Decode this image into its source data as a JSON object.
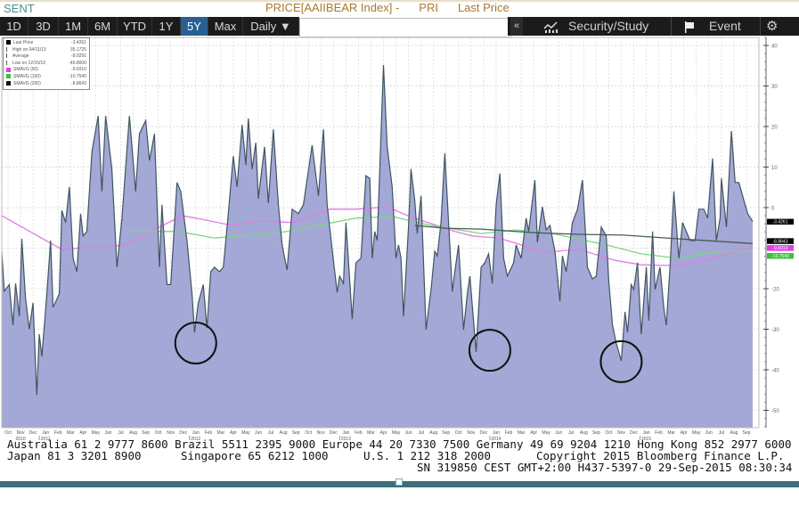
{
  "header": {
    "ticker_label": "SENT",
    "title_parts": [
      "PRICE[AAIIBEAR Index] -",
      "PRI",
      "Last Price"
    ]
  },
  "toolbar": {
    "ranges": [
      "1D",
      "3D",
      "1M",
      "6M",
      "YTD",
      "1Y",
      "5Y",
      "Max"
    ],
    "active_range": "5Y",
    "frequency": "Daily",
    "frequency_arrow": "▼",
    "input_value": "",
    "collapse_label": "«",
    "security_study_label": "Security/Study",
    "event_label": "Event",
    "icons": [
      "chart-study-icon",
      "flag-icon",
      "gear-icon"
    ]
  },
  "legend": [
    {
      "label": "Last Price",
      "value": "-3.4261",
      "color": "#000000",
      "marker": "square"
    },
    {
      "label": "High on 04/11/13",
      "value": "35.1725",
      "color": "#555555",
      "marker": "high"
    },
    {
      "label": "Average",
      "value": "-8.0291",
      "color": "#555555",
      "marker": "avg"
    },
    {
      "label": "Low on 12/15/10",
      "value": "-46.8000",
      "color": "#555555",
      "marker": "low"
    },
    {
      "label": "SMAVG (50)",
      "value": "-9.6910",
      "color": "#e040e0",
      "marker": "square"
    },
    {
      "label": "SMAVG (100)",
      "value": "-10.7540",
      "color": "#3cc03c",
      "marker": "square"
    },
    {
      "label": "SMAVG (200)",
      "value": "-8.8643",
      "color": "#111111",
      "marker": "square"
    }
  ],
  "chart_data": {
    "type": "area",
    "title": "PRICE[AAIIBEAR Index] - PRI Last Price",
    "x_unit": "months since Oct 2010",
    "xlim": [
      0,
      60.5
    ],
    "ylim": [
      -55,
      42
    ],
    "y_ticks": [
      40,
      30,
      20,
      10,
      0,
      -20,
      -30,
      -40,
      -50
    ],
    "month_labels": [
      "Oct",
      "Nov",
      "Dec",
      "Jan",
      "Feb",
      "Mar",
      "Apr",
      "May",
      "Jun",
      "Jul",
      "Aug",
      "Sep",
      "Oct",
      "Nov",
      "Dec",
      "Jan",
      "Feb",
      "Mar",
      "Apr",
      "May",
      "Jun",
      "Jul",
      "Aug",
      "Sep",
      "Oct",
      "Nov",
      "Dec",
      "Jan",
      "Feb",
      "Mar",
      "Apr",
      "May",
      "Jun",
      "Jul",
      "Aug",
      "Sep",
      "Oct",
      "Nov",
      "Dec",
      "Jan",
      "Feb",
      "Mar",
      "Apr",
      "May",
      "Jun",
      "Jul",
      "Aug",
      "Sep",
      "Oct",
      "Nov",
      "Dec",
      "Jan",
      "Feb",
      "Mar",
      "Apr",
      "May",
      "Jun",
      "Jul",
      "Aug",
      "Sep"
    ],
    "year_labels": [
      {
        "label": "2010",
        "month": 1
      },
      {
        "label": "2011",
        "month": 3
      },
      {
        "label": "2012",
        "month": 15
      },
      {
        "label": "2013",
        "month": 27
      },
      {
        "label": "2014",
        "month": 39
      },
      {
        "label": "2015",
        "month": 51
      }
    ],
    "grid": true,
    "series": [
      {
        "name": "Last Price",
        "color": "#3f5560",
        "fill_top": "#8fd3e3",
        "fill_bottom": "#a3a8d6",
        "points": [
          [
            0,
            -11
          ],
          [
            0.2,
            -20.6
          ],
          [
            0.6,
            -19
          ],
          [
            0.9,
            -29
          ],
          [
            1.1,
            -18.7
          ],
          [
            1.4,
            -26.8
          ],
          [
            1.6,
            -7.7
          ],
          [
            1.9,
            -22.4
          ],
          [
            2.2,
            -30
          ],
          [
            2.5,
            -23.5
          ],
          [
            2.8,
            -46.2
          ],
          [
            3.0,
            -31.2
          ],
          [
            3.2,
            -36.7
          ],
          [
            3.6,
            -21.3
          ],
          [
            3.9,
            -8.1
          ],
          [
            4.1,
            -24.6
          ],
          [
            4.6,
            -21.3
          ],
          [
            4.8,
            -0.7
          ],
          [
            5.1,
            -3.7
          ],
          [
            5.4,
            5.1
          ],
          [
            5.7,
            -12.5
          ],
          [
            6.0,
            -15.8
          ],
          [
            6.3,
            -1.5
          ],
          [
            6.5,
            -7
          ],
          [
            6.8,
            -5.9
          ],
          [
            7.2,
            13.8
          ],
          [
            7.7,
            22.6
          ],
          [
            8.0,
            4
          ],
          [
            8.3,
            22.6
          ],
          [
            8.8,
            9.5
          ],
          [
            9.2,
            -14.7
          ],
          [
            9.6,
            -2.6
          ],
          [
            10.2,
            22.6
          ],
          [
            10.7,
            4
          ],
          [
            11.0,
            18.2
          ],
          [
            11.5,
            21.5
          ],
          [
            11.8,
            11.6
          ],
          [
            12.2,
            18.2
          ],
          [
            12.6,
            -14.7
          ],
          [
            12.8,
            0.7
          ],
          [
            13.2,
            -19
          ],
          [
            13.5,
            -19
          ],
          [
            14.0,
            6.2
          ],
          [
            14.3,
            4
          ],
          [
            14.8,
            -8.1
          ],
          [
            15.2,
            -21.3
          ],
          [
            15.4,
            -30.8
          ],
          [
            15.7,
            -23.5
          ],
          [
            16.1,
            -19
          ],
          [
            16.4,
            -29.7
          ],
          [
            16.7,
            -15.8
          ],
          [
            17.0,
            -14.7
          ],
          [
            17.4,
            -15.8
          ],
          [
            17.7,
            -14.7
          ],
          [
            18.1,
            -1.5
          ],
          [
            18.5,
            12.7
          ],
          [
            18.8,
            5.1
          ],
          [
            19.2,
            20.4
          ],
          [
            19.5,
            10.5
          ],
          [
            19.7,
            22
          ],
          [
            20.0,
            9.5
          ],
          [
            20.3,
            16
          ],
          [
            20.5,
            2.2
          ],
          [
            21.0,
            15
          ],
          [
            21.3,
            1.1
          ],
          [
            21.7,
            19.3
          ],
          [
            22.1,
            0.7
          ],
          [
            22.4,
            -9.2
          ],
          [
            22.8,
            -15.4
          ],
          [
            23.2,
            -0.4
          ],
          [
            23.7,
            -1.5
          ],
          [
            24.1,
            0.7
          ],
          [
            24.8,
            15.4
          ],
          [
            25.3,
            2.9
          ],
          [
            25.7,
            19.3
          ],
          [
            26.0,
            0.7
          ],
          [
            26.4,
            -10.3
          ],
          [
            26.8,
            -20.9
          ],
          [
            27.0,
            -16.9
          ],
          [
            27.3,
            -18.7
          ],
          [
            27.5,
            -3.7
          ],
          [
            28.0,
            -27.5
          ],
          [
            28.3,
            -13.6
          ],
          [
            28.7,
            -12.5
          ],
          [
            29.1,
            7.9
          ],
          [
            29.4,
            7.2
          ],
          [
            29.6,
            -12.5
          ],
          [
            29.8,
            -5.9
          ],
          [
            30.0,
            -8.1
          ],
          [
            30.5,
            35.17
          ],
          [
            30.8,
            15
          ],
          [
            31.2,
            5.1
          ],
          [
            31.5,
            -12.5
          ],
          [
            31.7,
            -9.2
          ],
          [
            31.9,
            -12.5
          ],
          [
            32.1,
            -26.8
          ],
          [
            32.5,
            -4.8
          ],
          [
            32.7,
            9.5
          ],
          [
            33.0,
            1.8
          ],
          [
            33.2,
            -6.4
          ],
          [
            33.5,
            2.9
          ],
          [
            33.9,
            -30.1
          ],
          [
            34.3,
            -20.2
          ],
          [
            34.6,
            -10.8
          ],
          [
            34.8,
            -11.9
          ],
          [
            35.1,
            -3.7
          ],
          [
            35.4,
            13.4
          ],
          [
            35.7,
            -3.7
          ],
          [
            36.0,
            -20.7
          ],
          [
            36.2,
            -15.8
          ],
          [
            36.5,
            -9.2
          ],
          [
            36.9,
            -30.1
          ],
          [
            37.2,
            -21.3
          ],
          [
            37.4,
            -16.9
          ],
          [
            37.9,
            -35.6
          ],
          [
            38.3,
            -14.7
          ],
          [
            38.6,
            -13.6
          ],
          [
            38.9,
            -11.4
          ],
          [
            39.2,
            -18.7
          ],
          [
            39.5,
            0.7
          ],
          [
            39.8,
            8.4
          ],
          [
            40.1,
            -12.5
          ],
          [
            40.4,
            -16.9
          ],
          [
            40.9,
            -13.6
          ],
          [
            41.1,
            -9.2
          ],
          [
            41.5,
            -12.5
          ],
          [
            41.9,
            -2.6
          ],
          [
            42.1,
            -5.9
          ],
          [
            42.6,
            6.8
          ],
          [
            42.8,
            -8.6
          ],
          [
            43.2,
            0.2
          ],
          [
            43.5,
            -5.5
          ],
          [
            43.8,
            -4.4
          ],
          [
            44.2,
            -10.8
          ],
          [
            44.6,
            -23.1
          ],
          [
            44.8,
            -11.9
          ],
          [
            45.1,
            -15.8
          ],
          [
            45.6,
            -3.7
          ],
          [
            46.0,
            -0.4
          ],
          [
            46.4,
            6.8
          ],
          [
            46.8,
            -14.7
          ],
          [
            47.2,
            -17.6
          ],
          [
            47.5,
            -16.9
          ],
          [
            47.9,
            -4.8
          ],
          [
            48.3,
            -7
          ],
          [
            48.5,
            -18
          ],
          [
            48.8,
            -29
          ],
          [
            49.1,
            -33.4
          ],
          [
            49.5,
            -37.8
          ],
          [
            49.8,
            -25.7
          ],
          [
            50.0,
            -30.8
          ],
          [
            50.3,
            -19
          ],
          [
            50.5,
            -20.2
          ],
          [
            50.8,
            -13.6
          ],
          [
            51.1,
            -31.2
          ],
          [
            51.5,
            -14.7
          ],
          [
            51.7,
            -27.9
          ],
          [
            52.0,
            -5.9
          ],
          [
            52.2,
            -20.2
          ],
          [
            52.6,
            -14.7
          ],
          [
            52.9,
            -24.6
          ],
          [
            53.1,
            -29
          ],
          [
            53.4,
            -14.7
          ],
          [
            53.7,
            4
          ],
          [
            54.1,
            -12.5
          ],
          [
            54.4,
            -3.7
          ],
          [
            54.7,
            -5.9
          ],
          [
            55.0,
            -8.1
          ],
          [
            55.4,
            -8.1
          ],
          [
            55.7,
            -0.4
          ],
          [
            56.1,
            -0.4
          ],
          [
            56.4,
            -2.6
          ],
          [
            56.8,
            12.1
          ],
          [
            57.1,
            -8.1
          ],
          [
            57.4,
            -2.6
          ],
          [
            57.5,
            7.2
          ],
          [
            57.9,
            -4.8
          ],
          [
            58.3,
            18.9
          ],
          [
            58.6,
            6.2
          ],
          [
            58.9,
            6.2
          ],
          [
            59.4,
            0.7
          ],
          [
            59.6,
            -1.5
          ],
          [
            60.0,
            -3.43
          ]
        ]
      },
      {
        "name": "SMAVG (50)",
        "color": "#e27ce8",
        "points": [
          [
            0,
            -2.0
          ],
          [
            4.8,
            -10.3
          ],
          [
            6.6,
            -9.9
          ],
          [
            8.4,
            -9.7
          ],
          [
            9.8,
            -9.2
          ],
          [
            14.4,
            -2.0
          ],
          [
            15.5,
            -2.6
          ],
          [
            18.4,
            -4.4
          ],
          [
            20.5,
            -3.3
          ],
          [
            23.3,
            -3.7
          ],
          [
            24.1,
            -2.6
          ],
          [
            26.2,
            -0.4
          ],
          [
            28.3,
            -0.4
          ],
          [
            30.8,
            0.2
          ],
          [
            32.6,
            -2.2
          ],
          [
            36.2,
            -5.9
          ],
          [
            37.6,
            -7.0
          ],
          [
            39.7,
            -7.5
          ],
          [
            41.1,
            -8.8
          ],
          [
            43.3,
            -11.0
          ],
          [
            46.1,
            -10.3
          ],
          [
            49.0,
            -13.0
          ],
          [
            51.1,
            -14.1
          ],
          [
            54.0,
            -14.3
          ],
          [
            56.8,
            -12.5
          ],
          [
            60.0,
            -9.69
          ]
        ]
      },
      {
        "name": "SMAVG (100)",
        "color": "#7ed67e",
        "points": [
          [
            10.2,
            -5.9
          ],
          [
            14.1,
            -5.9
          ],
          [
            17.0,
            -7.5
          ],
          [
            19.8,
            -6.8
          ],
          [
            21.2,
            -6.8
          ],
          [
            28.3,
            -2.6
          ],
          [
            31.2,
            -2.2
          ],
          [
            34.0,
            -4.2
          ],
          [
            38.3,
            -6.4
          ],
          [
            41.1,
            -5.5
          ],
          [
            44.0,
            -6.4
          ],
          [
            48.3,
            -9.2
          ],
          [
            51.1,
            -11.4
          ],
          [
            54.0,
            -12.5
          ],
          [
            56.8,
            -11.0
          ],
          [
            60.0,
            -10.75
          ]
        ]
      },
      {
        "name": "SMAVG (200)",
        "color": "#4a5a55",
        "points": [
          [
            33.0,
            -4.4
          ],
          [
            35.5,
            -5.1
          ],
          [
            38.3,
            -5.3
          ],
          [
            42.6,
            -6.2
          ],
          [
            46.1,
            -6.6
          ],
          [
            49.7,
            -6.8
          ],
          [
            54.0,
            -7.7
          ],
          [
            60.0,
            -8.86
          ]
        ]
      }
    ],
    "annotations": [
      {
        "type": "circle",
        "month": 15.5,
        "value": -33.4
      },
      {
        "type": "circle",
        "month": 39.0,
        "value": -35.2
      },
      {
        "type": "circle",
        "month": 49.5,
        "value": -38.0
      }
    ],
    "axis_tags": [
      {
        "value": -3.4261,
        "label": "-3.4261",
        "color": "#000000"
      },
      {
        "value": -8.8643,
        "label": "-8.8643",
        "color": "#000000"
      },
      {
        "value": -9.691,
        "label": "-9.6910",
        "color": "#e040e0"
      },
      {
        "value": -10.754,
        "label": "-10.7540",
        "color": "#3cc03c"
      }
    ]
  },
  "footer": {
    "line1": "Australia 61 2 9777 8600 Brazil 5511 2395 9000 Europe 44 20 7330 7500 Germany 49 69 9204 1210 Hong Kong 852 2977 6000",
    "line2a": "Japan 81 3 3201 8900",
    "line2b": "Singapore 65 6212 1000",
    "line2c": "U.S. 1 212 318 2000",
    "line2d": "Copyright 2015 Bloomberg Finance L.P.",
    "line3": "SN 319850 CEST GMT+2:00 H437-5397-0 29-Sep-2015 08:30:34"
  }
}
